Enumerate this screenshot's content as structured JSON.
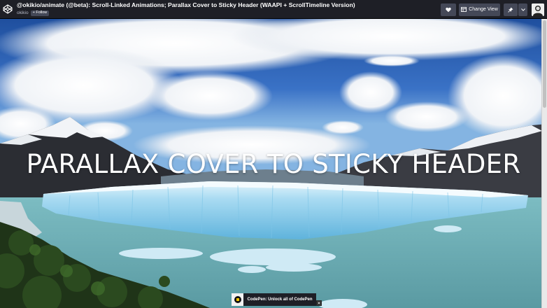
{
  "header": {
    "pen_title": "@okikio/animate (@beta): Scroll-Linked Animations; Parallax Cover to Sticky Header (WAAPI + ScrollTimeline Version)",
    "owner": "okikio",
    "follow_label": "+ Follow",
    "change_view_label": "Change View",
    "icons": {
      "logo": "codepen-logo-icon",
      "heart": "heart-icon",
      "change_view": "layout-icon",
      "pin": "pin-icon",
      "dropdown": "chevron-down-icon",
      "avatar": "user-avatar"
    }
  },
  "preview": {
    "hero_title": "PARALLAX COVER TO STICKY HEADER"
  },
  "ad": {
    "text": "CodePen: Unlock all of CodePen",
    "close": "✕"
  },
  "colors": {
    "topbar": "#1e1f26",
    "button": "#444857",
    "sky": "#3d73c3",
    "ice": "#9fd3ee",
    "water": "#6fb1b8"
  }
}
